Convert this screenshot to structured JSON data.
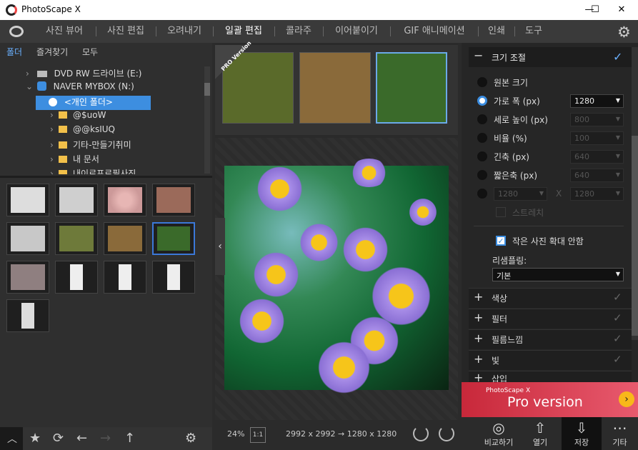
{
  "window": {
    "title": "PhotoScape X",
    "min": "—",
    "max": "☐",
    "close": "✕"
  },
  "menu": {
    "items": [
      "사진 뷰어",
      "사진 편집",
      "오려내기",
      "일괄 편집",
      "콜라주",
      "이어붙이기",
      "GIF 애니메이션",
      "인쇄",
      "도구"
    ],
    "active_index": 3
  },
  "left": {
    "tabs": [
      "폴더",
      "즐겨찾기",
      "모두"
    ],
    "tree": [
      {
        "label": "DVD RW 드라이브 (E:)",
        "chev": "›"
      },
      {
        "label": "NAVER MYBOX (N:)",
        "chev": "⌄"
      },
      {
        "label": "<개인 폴더>",
        "chev": ""
      },
      {
        "label": "@$uoW",
        "chev": "›"
      },
      {
        "label": "@@ksIUQ",
        "chev": "›"
      },
      {
        "label": "기타-만들기취미",
        "chev": "›"
      },
      {
        "label": "내 문서",
        "chev": "›"
      },
      {
        "label": "내이로프로필사진",
        "chev": "›"
      }
    ]
  },
  "center": {
    "pro_badge": "PRO Version",
    "zoom": "24%",
    "zoom_button": "1:1",
    "size_info": "2992 x 2992 → 1280 x 1280"
  },
  "resize": {
    "title": "크기 조절",
    "options": [
      "원본 크기",
      "가로 폭 (px)",
      "세로 높이 (px)",
      "비율 (%)",
      "긴축 (px)",
      "짧은축 (px)"
    ],
    "values": [
      "1280",
      "800",
      "100",
      "640",
      "640"
    ],
    "custom_w": "1280",
    "custom_h": "1280",
    "custom_x": "X",
    "stretch": "스트레치",
    "no_upscale": "작은 사진 확대 안함",
    "resampling_label": "리샘플링:",
    "resampling_value": "기본"
  },
  "sections": [
    "색상",
    "필터",
    "필름느낌",
    "빛",
    "삽입"
  ],
  "banner": {
    "sub": "PhotoScape X",
    "main": "Pro version"
  },
  "bottom_buttons": [
    "비교하기",
    "열기",
    "저장",
    "기타"
  ]
}
